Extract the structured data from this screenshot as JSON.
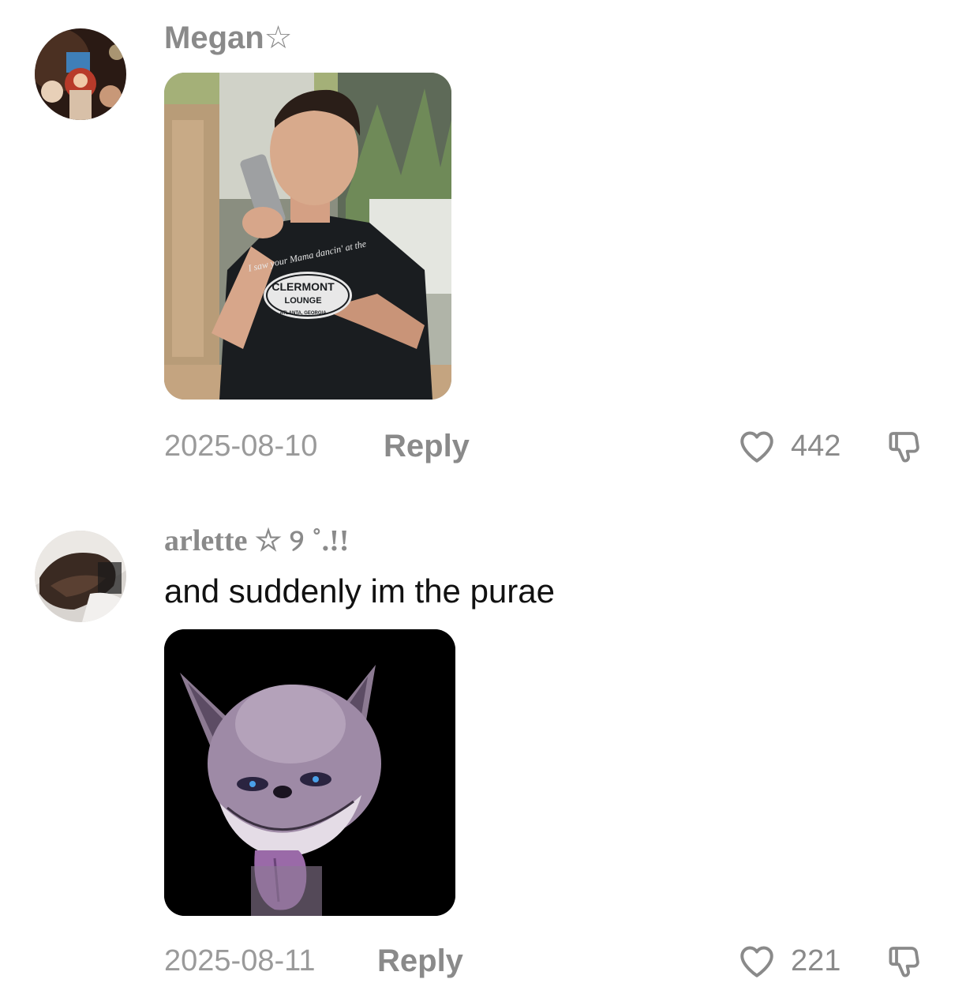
{
  "comments": [
    {
      "username": "Megan☆",
      "text": "",
      "media": {
        "type": "photo",
        "shirt_text_1": "I saw your Mama dancin' at the",
        "shirt_text_2": "CLERMONT",
        "shirt_text_3": "LOUNGE",
        "shirt_text_4": "ATLANTA, GEORGIA"
      },
      "date": "2025-08-10",
      "reply_label": "Reply",
      "likes": "442"
    },
    {
      "username": "arlette ☆ ୨ ˚.!!",
      "text": "and suddenly im the purae",
      "media": {
        "type": "sticker"
      },
      "date": "2025-08-11",
      "reply_label": "Reply",
      "likes": "221"
    }
  ],
  "icons": {
    "like": "heart-outline-icon",
    "dislike": "thumbs-down-outline-icon"
  },
  "colors": {
    "meta_gray": "#8a8a8a",
    "text": "#111111",
    "background": "#ffffff"
  }
}
